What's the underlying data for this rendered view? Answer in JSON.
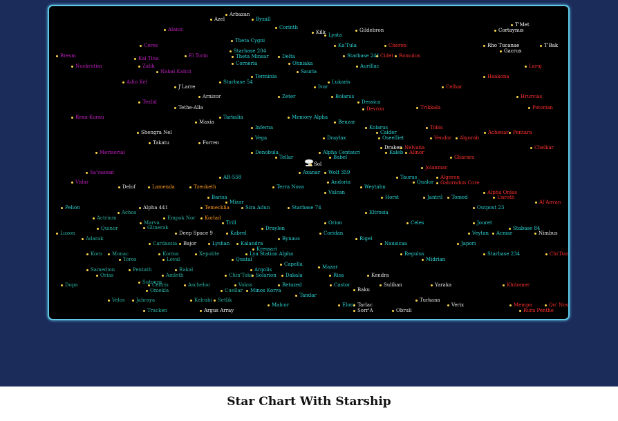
{
  "caption": "Star Chart With Starship",
  "colors": {
    "federation": "#29d4d4",
    "neutral": "#e6e6e6",
    "romulan": "#ff3030",
    "klingon": "#ff4040",
    "cardassian": "#2ab5a5",
    "ferengi": "#c020c0",
    "orange": "#ff9a20",
    "white": "#ffffff",
    "dot": "#ffd84a"
  },
  "ship": {
    "name": "Sol",
    "icon": "starship-icon"
  },
  "stars": [
    {
      "name": "Arbazan",
      "c": "neutral"
    },
    {
      "name": "Azel",
      "c": "neutral"
    },
    {
      "name": "Byzall",
      "c": "federation"
    },
    {
      "name": "Alanic",
      "c": "ferengi"
    },
    {
      "name": "Corinth",
      "c": "federation"
    },
    {
      "name": "Kilk",
      "c": "white"
    },
    {
      "name": "Lyata",
      "c": "federation"
    },
    {
      "name": "Gildebron",
      "c": "neutral"
    },
    {
      "name": "T'Met",
      "c": "white"
    },
    {
      "name": "Cortaynus",
      "c": "white"
    },
    {
      "name": "Theta Cygni",
      "c": "federation"
    },
    {
      "name": "Ka'Tula",
      "c": "federation"
    },
    {
      "name": "Cheron",
      "c": "romulan"
    },
    {
      "name": "Rho Tucanae",
      "c": "white"
    },
    {
      "name": "T'Bak",
      "c": "white"
    },
    {
      "name": "Gacrux",
      "c": "white"
    },
    {
      "name": "Ceres",
      "c": "ferengi"
    },
    {
      "name": "Starbase 204",
      "c": "federation"
    },
    {
      "name": "Theta Minsar",
      "c": "federation"
    },
    {
      "name": "Starbase 241",
      "c": "federation"
    },
    {
      "name": "Cidet",
      "c": "romulan"
    },
    {
      "name": "Romulus",
      "c": "romulan"
    },
    {
      "name": "Bresm",
      "c": "ferengi"
    },
    {
      "name": "Kal Tina",
      "c": "ferengi"
    },
    {
      "name": "El Torin",
      "c": "ferengi"
    },
    {
      "name": "Delta",
      "c": "federation"
    },
    {
      "name": "Ohniaka",
      "c": "federation"
    },
    {
      "name": "Zalik",
      "c": "ferengi"
    },
    {
      "name": "Corneria",
      "c": "federation"
    },
    {
      "name": "Aurillac",
      "c": "federation"
    },
    {
      "name": "Laruj",
      "c": "romulan"
    },
    {
      "name": "Nuckrutim",
      "c": "ferengi"
    },
    {
      "name": "Nabal Kaitol",
      "c": "ferengi"
    },
    {
      "name": "Sauria",
      "c": "federation"
    },
    {
      "name": "Haakona",
      "c": "romulan"
    },
    {
      "name": "Terminia",
      "c": "federation"
    },
    {
      "name": "Adin Kel",
      "c": "ferengi"
    },
    {
      "name": "Starbase 54",
      "c": "federation"
    },
    {
      "name": "Lukaris",
      "c": "federation"
    },
    {
      "name": "J'Larre",
      "c": "neutral"
    },
    {
      "name": "Ivor",
      "c": "federation"
    },
    {
      "name": "Celhar",
      "c": "romulan"
    },
    {
      "name": "Arnizor",
      "c": "neutral"
    },
    {
      "name": "Zeter",
      "c": "federation"
    },
    {
      "name": "Bolarus",
      "c": "federation"
    },
    {
      "name": "Hrurvias",
      "c": "romulan"
    },
    {
      "name": "Tezlid",
      "c": "ferengi"
    },
    {
      "name": "Dessica",
      "c": "federation"
    },
    {
      "name": "Tethe-Alla",
      "c": "neutral"
    },
    {
      "name": "Devron",
      "c": "romulan"
    },
    {
      "name": "Trikkala",
      "c": "romulan"
    },
    {
      "name": "Potorian",
      "c": "romulan"
    },
    {
      "name": "Rexa-Kurau",
      "c": "ferengi"
    },
    {
      "name": "Tarkalia",
      "c": "federation"
    },
    {
      "name": "Memory Alpha",
      "c": "federation"
    },
    {
      "name": "Maxia",
      "c": "neutral"
    },
    {
      "name": "Benzar",
      "c": "federation"
    },
    {
      "name": "Inferna",
      "c": "federation"
    },
    {
      "name": "Kolarus",
      "c": "federation"
    },
    {
      "name": "Tobis",
      "c": "romulan"
    },
    {
      "name": "Shengra Nel",
      "c": "neutral"
    },
    {
      "name": "Calder",
      "c": "federation"
    },
    {
      "name": "Achenar",
      "c": "romulan"
    },
    {
      "name": "Pentara",
      "c": "romulan"
    },
    {
      "name": "Vega",
      "c": "federation"
    },
    {
      "name": "Draylax",
      "c": "federation"
    },
    {
      "name": "Oseelliet",
      "c": "federation"
    },
    {
      "name": "Vendor",
      "c": "romulan"
    },
    {
      "name": "Algorab",
      "c": "romulan"
    },
    {
      "name": "Takatu",
      "c": "neutral"
    },
    {
      "name": "Forren",
      "c": "neutral"
    },
    {
      "name": "Draken",
      "c": "white"
    },
    {
      "name": "Nelvana",
      "c": "romulan"
    },
    {
      "name": "Chelkar",
      "c": "romulan"
    },
    {
      "name": "Merisorial",
      "c": "ferengi"
    },
    {
      "name": "Denobula",
      "c": "federation"
    },
    {
      "name": "Alpha Centauri",
      "c": "federation"
    },
    {
      "name": "Kaleb",
      "c": "federation"
    },
    {
      "name": "Alinor",
      "c": "romulan"
    },
    {
      "name": "Tellar",
      "c": "federation"
    },
    {
      "name": "Babel",
      "c": "federation"
    },
    {
      "name": "Gharara",
      "c": "romulan"
    },
    {
      "name": "Sol",
      "c": "white"
    },
    {
      "name": "Jolanmar",
      "c": "romulan"
    },
    {
      "name": "Sa'vassan",
      "c": "ferengi"
    },
    {
      "name": "Axanar",
      "c": "federation"
    },
    {
      "name": "Wolf 359",
      "c": "federation"
    },
    {
      "name": "AR-558",
      "c": "federation"
    },
    {
      "name": "Taurus",
      "c": "federation"
    },
    {
      "name": "Algeron",
      "c": "romulan"
    },
    {
      "name": "Qualor",
      "c": "federation"
    },
    {
      "name": "Galorndon Core",
      "c": "romulan"
    },
    {
      "name": "Vidar",
      "c": "ferengi"
    },
    {
      "name": "Andoria",
      "c": "federation"
    },
    {
      "name": "Delof",
      "c": "neutral"
    },
    {
      "name": "Lamenda",
      "c": "orange"
    },
    {
      "name": "Tzenketh",
      "c": "orange"
    },
    {
      "name": "Terra Nova",
      "c": "federation"
    },
    {
      "name": "Weytahn",
      "c": "federation"
    },
    {
      "name": "Vulcan",
      "c": "federation"
    },
    {
      "name": "Alpha Onias",
      "c": "romulan"
    },
    {
      "name": "Unroth",
      "c": "romulan"
    },
    {
      "name": "Barisa",
      "c": "federation"
    },
    {
      "name": "Horst",
      "c": "federation"
    },
    {
      "name": "Jantril",
      "c": "federation"
    },
    {
      "name": "Tomed",
      "c": "federation"
    },
    {
      "name": "Al'Anvan",
      "c": "romulan"
    },
    {
      "name": "Mizar",
      "c": "federation"
    },
    {
      "name": "Pelion",
      "c": "federation"
    },
    {
      "name": "Alpha 441",
      "c": "neutral"
    },
    {
      "name": "Temecklia",
      "c": "orange"
    },
    {
      "name": "Sira Adun",
      "c": "federation"
    },
    {
      "name": "Starbase 74",
      "c": "federation"
    },
    {
      "name": "Outpost 23",
      "c": "federation"
    },
    {
      "name": "Achos",
      "c": "cardassian"
    },
    {
      "name": "Eltrosia",
      "c": "federation"
    },
    {
      "name": "Actrium",
      "c": "cardassian"
    },
    {
      "name": "Empok Nor",
      "c": "cardassian"
    },
    {
      "name": "Korlad",
      "c": "orange"
    },
    {
      "name": "Marva",
      "c": "cardassian"
    },
    {
      "name": "Trill",
      "c": "federation"
    },
    {
      "name": "Orion",
      "c": "federation"
    },
    {
      "name": "Celes",
      "c": "federation"
    },
    {
      "name": "Jouret",
      "c": "federation"
    },
    {
      "name": "Quinor",
      "c": "cardassian"
    },
    {
      "name": "Glinerak",
      "c": "cardassian"
    },
    {
      "name": "Draylon",
      "c": "federation"
    },
    {
      "name": "Stabase 84",
      "c": "federation"
    },
    {
      "name": "Luzon",
      "c": "cardassian"
    },
    {
      "name": "Deep Space 9",
      "c": "neutral"
    },
    {
      "name": "Kabrel",
      "c": "federation"
    },
    {
      "name": "Coridan",
      "c": "federation"
    },
    {
      "name": "Veytan",
      "c": "federation"
    },
    {
      "name": "Acmar",
      "c": "federation"
    },
    {
      "name": "Nimbus",
      "c": "neutral"
    },
    {
      "name": "Adarak",
      "c": "cardassian"
    },
    {
      "name": "Bynaus",
      "c": "federation"
    },
    {
      "name": "Rigel",
      "c": "federation"
    },
    {
      "name": "Japori",
      "c": "federation"
    },
    {
      "name": "Cardassia",
      "c": "cardassian"
    },
    {
      "name": "Bajor",
      "c": "neutral"
    },
    {
      "name": "Lyshan",
      "c": "federation"
    },
    {
      "name": "Kalandra",
      "c": "federation"
    },
    {
      "name": "Nausicaa",
      "c": "federation"
    },
    {
      "name": "Kressari",
      "c": "federation"
    },
    {
      "name": "Lya Station Alpha",
      "c": "federation"
    },
    {
      "name": "Korn",
      "c": "cardassian"
    },
    {
      "name": "Monac",
      "c": "cardassian"
    },
    {
      "name": "Korma",
      "c": "cardassian"
    },
    {
      "name": "Xepolite",
      "c": "cardassian"
    },
    {
      "name": "Regulus",
      "c": "federation"
    },
    {
      "name": "Starbase 234",
      "c": "federation"
    },
    {
      "name": "Chi'Dan",
      "c": "romulan"
    },
    {
      "name": "Toros",
      "c": "cardassian"
    },
    {
      "name": "Loval",
      "c": "cardassian"
    },
    {
      "name": "Quatal",
      "c": "federation"
    },
    {
      "name": "Midrian",
      "c": "federation"
    },
    {
      "name": "Capella",
      "c": "federation"
    },
    {
      "name": "Mazar",
      "c": "federation"
    },
    {
      "name": "Samedion",
      "c": "cardassian"
    },
    {
      "name": "Pentath",
      "c": "cardassian"
    },
    {
      "name": "Rakal",
      "c": "cardassian"
    },
    {
      "name": "Argolis",
      "c": "federation"
    },
    {
      "name": "Orias",
      "c": "cardassian"
    },
    {
      "name": "Amleth",
      "c": "cardassian"
    },
    {
      "name": "Chin'Toka",
      "c": "cardassian"
    },
    {
      "name": "Solarion",
      "c": "federation"
    },
    {
      "name": "Dakala",
      "c": "federation"
    },
    {
      "name": "Risa",
      "c": "federation"
    },
    {
      "name": "Kendra",
      "c": "neutral"
    },
    {
      "name": "Sutoura",
      "c": "cardassian"
    },
    {
      "name": "Dopa",
      "c": "cardassian"
    },
    {
      "name": "Celtris",
      "c": "cardassian"
    },
    {
      "name": "Ascheloo",
      "c": "cardassian"
    },
    {
      "name": "Vokss",
      "c": "cardassian"
    },
    {
      "name": "Betazed",
      "c": "federation"
    },
    {
      "name": "Castor",
      "c": "federation"
    },
    {
      "name": "Suliban",
      "c": "neutral"
    },
    {
      "name": "Yaraka",
      "c": "neutral"
    },
    {
      "name": "Khitomer",
      "c": "romulan"
    },
    {
      "name": "Omekla",
      "c": "cardassian"
    },
    {
      "name": "Cuellar",
      "c": "cardassian"
    },
    {
      "name": "Minos Korva",
      "c": "federation"
    },
    {
      "name": "Baku",
      "c": "neutral"
    },
    {
      "name": "Tandar",
      "c": "federation"
    },
    {
      "name": "Velos",
      "c": "cardassian"
    },
    {
      "name": "Jahraya",
      "c": "cardassian"
    },
    {
      "name": "Kelrabi",
      "c": "cardassian"
    },
    {
      "name": "Setlik",
      "c": "cardassian"
    },
    {
      "name": "Turkana",
      "c": "neutral"
    },
    {
      "name": "Malcor",
      "c": "federation"
    },
    {
      "name": "Elora",
      "c": "federation"
    },
    {
      "name": "Tarlac",
      "c": "neutral"
    },
    {
      "name": "Verix",
      "c": "neutral"
    },
    {
      "name": "Mempa",
      "c": "romulan"
    },
    {
      "name": "Qo' Nos",
      "c": "romulan"
    },
    {
      "name": "Tracken",
      "c": "cardassian"
    },
    {
      "name": "Argus Array",
      "c": "white"
    },
    {
      "name": "Sorr'A",
      "c": "neutral"
    },
    {
      "name": "Obruli",
      "c": "neutral"
    },
    {
      "name": "Rura Penthe",
      "c": "romulan"
    }
  ]
}
